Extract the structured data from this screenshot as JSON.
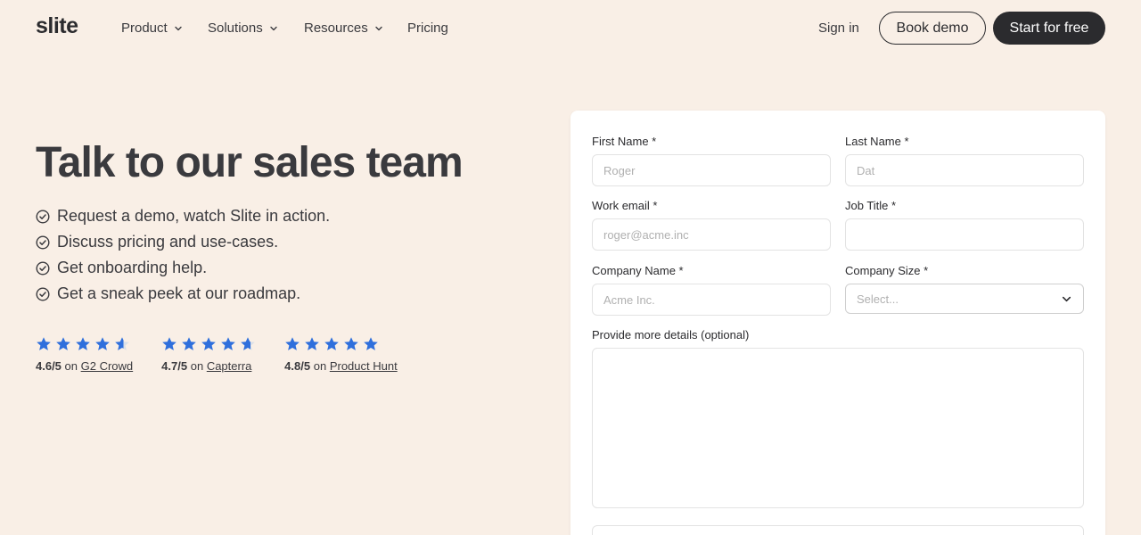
{
  "nav": {
    "logo": "slite",
    "items": [
      {
        "label": "Product",
        "has_dropdown": true
      },
      {
        "label": "Solutions",
        "has_dropdown": true
      },
      {
        "label": "Resources",
        "has_dropdown": true
      },
      {
        "label": "Pricing",
        "has_dropdown": false
      }
    ],
    "sign_in": "Sign in",
    "book_demo": "Book demo",
    "start_free": "Start for free"
  },
  "hero": {
    "title": "Talk to our sales team",
    "bullets": [
      "Request a demo, watch Slite in action.",
      "Discuss pricing and use-cases.",
      "Get onboarding help.",
      "Get a sneak peek at our roadmap."
    ]
  },
  "ratings": [
    {
      "score": "4.6/5",
      "on": "on",
      "source": "G2 Crowd",
      "stars": 4.6
    },
    {
      "score": "4.7/5",
      "on": "on",
      "source": "Capterra",
      "stars": 4.7
    },
    {
      "score": "4.8/5",
      "on": "on",
      "source": "Product Hunt",
      "stars": 5
    }
  ],
  "form": {
    "first_name": {
      "label": "First Name *",
      "placeholder": "Roger"
    },
    "last_name": {
      "label": "Last Name *",
      "placeholder": "Dat"
    },
    "work_email": {
      "label": "Work email *",
      "placeholder": "roger@acme.inc"
    },
    "job_title": {
      "label": "Job Title *",
      "placeholder": ""
    },
    "company_name": {
      "label": "Company Name *",
      "placeholder": "Acme Inc."
    },
    "company_size": {
      "label": "Company Size *",
      "placeholder": "Select..."
    },
    "details": {
      "label": "Provide more details (optional)",
      "placeholder": ""
    }
  },
  "colors": {
    "background": "#f9efe6",
    "text": "#2b2b2e",
    "star": "#2f6fdc",
    "button_dark": "#2b2b2e"
  },
  "icons": {
    "check": "check-circle-icon",
    "star": "star-icon",
    "chevron": "chevron-down-icon"
  }
}
